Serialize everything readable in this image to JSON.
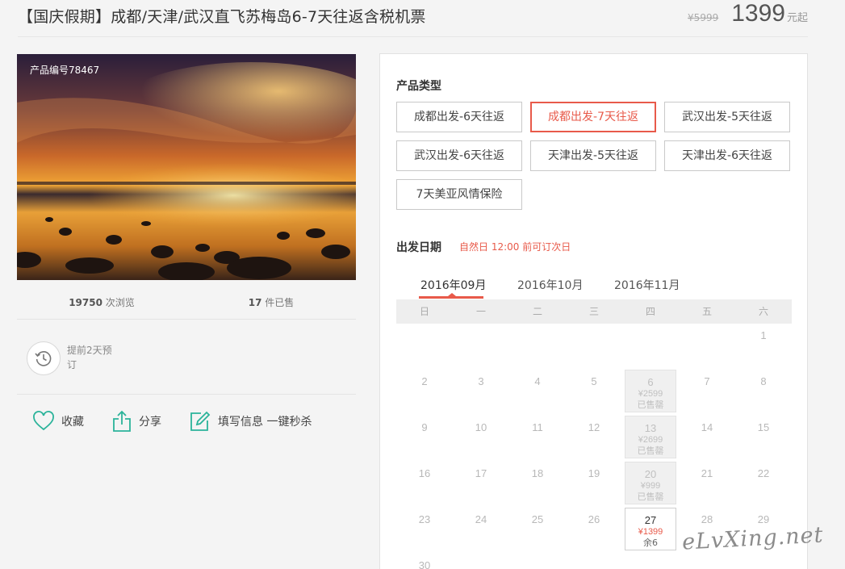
{
  "header": {
    "title": "【国庆假期】成都/天津/武汉直飞苏梅岛6-7天往返含税机票",
    "old_price": "¥5999",
    "price": "1399",
    "price_unit": "元起"
  },
  "photo": {
    "product_no": "产品编号78467"
  },
  "stats": {
    "views_num": "19750",
    "views_label": " 次浏览",
    "sold_num": "17",
    "sold_label": " 件已售"
  },
  "booking": {
    "text": "提前2天预订"
  },
  "actions": {
    "favorite": "收藏",
    "share": "分享",
    "fill_info": "填写信息 一键秒杀"
  },
  "panel": {
    "type_title": "产品类型",
    "types": [
      "成都出发-6天往返",
      "成都出发-7天往返",
      "武汉出发-5天往返",
      "武汉出发-6天往返",
      "天津出发-5天往返",
      "天津出发-6天往返",
      "7天美亚风情保险"
    ],
    "active_type_index": 1,
    "date_title": "出发日期",
    "date_note": "自然日 12:00 前可订次日",
    "months": [
      "2016年09月",
      "2016年10月",
      "2016年11月"
    ],
    "active_month_index": 0,
    "weekdays": [
      "日",
      "一",
      "二",
      "三",
      "四",
      "五",
      "六"
    ],
    "days": [
      {
        "day": "1"
      },
      {
        "day": "2"
      },
      {
        "day": "3"
      },
      {
        "day": "4"
      },
      {
        "day": "5"
      },
      {
        "day": "6",
        "price": "¥2599",
        "status": "已售罄",
        "state": "sold"
      },
      {
        "day": "7"
      },
      {
        "day": "8"
      },
      {
        "day": "9"
      },
      {
        "day": "10"
      },
      {
        "day": "11"
      },
      {
        "day": "12"
      },
      {
        "day": "13",
        "price": "¥2699",
        "status": "已售罄",
        "state": "sold"
      },
      {
        "day": "14"
      },
      {
        "day": "15"
      },
      {
        "day": "16"
      },
      {
        "day": "17"
      },
      {
        "day": "18"
      },
      {
        "day": "19"
      },
      {
        "day": "20",
        "price": "¥999",
        "status": "已售罄",
        "state": "sold"
      },
      {
        "day": "21"
      },
      {
        "day": "22"
      },
      {
        "day": "23"
      },
      {
        "day": "24"
      },
      {
        "day": "25"
      },
      {
        "day": "26"
      },
      {
        "day": "27",
        "price": "¥1399",
        "status": "余6",
        "state": "avail"
      },
      {
        "day": "28"
      },
      {
        "day": "29"
      },
      {
        "day": "30"
      }
    ],
    "first_weekday": 4
  },
  "watermark": "eLvXing.net",
  "colors": {
    "accent": "#e85a4a",
    "icon_green": "#2bb39a"
  }
}
